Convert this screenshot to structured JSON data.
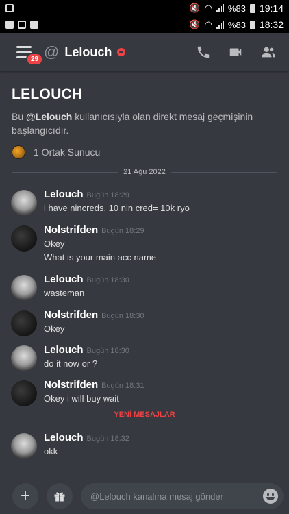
{
  "status_outer": {
    "battery": "%83",
    "time": "19:14"
  },
  "status_inner": {
    "battery": "%83",
    "time": "18:32"
  },
  "header": {
    "badge": "29",
    "channel": "Lelouch"
  },
  "intro": {
    "title": "LELOUCH",
    "text_prefix": "Bu ",
    "mention": "@Lelouch",
    "text_suffix": " kullanıcısıyla olan direkt mesaj geçmişinin başlangıcıdır.",
    "mutual_servers": "1 Ortak Sunucu"
  },
  "date_divider": "21 Ağu 2022",
  "new_messages_label": "YENİ MESAJLAR",
  "messages": [
    {
      "author": "Lelouch",
      "time": "Bugün 18:29",
      "lines": [
        "i have nincreds, 10 nin cred= 10k ryo"
      ]
    },
    {
      "author": "Nolstrifden",
      "time": "Bugün 18:29",
      "lines": [
        "Okey",
        "What is your main acc name"
      ]
    },
    {
      "author": "Lelouch",
      "time": "Bugün 18:30",
      "lines": [
        "wasteman"
      ]
    },
    {
      "author": "Nolstrifden",
      "time": "Bugün 18:30",
      "lines": [
        "Okey"
      ]
    },
    {
      "author": "Lelouch",
      "time": "Bugün 18:30",
      "lines": [
        "do it now or ?"
      ]
    },
    {
      "author": "Nolstrifden",
      "time": "Bugün 18:31",
      "lines": [
        "Okey i will buy wait"
      ]
    },
    {
      "author": "Lelouch",
      "time": "Bugün 18:32",
      "lines": [
        "okk"
      ]
    }
  ],
  "composer": {
    "placeholder": "@Lelouch kanalına mesaj gönder"
  },
  "colors": {
    "background": "#36393f",
    "accent_red": "#ed4245",
    "input_bg": "#40444b"
  }
}
